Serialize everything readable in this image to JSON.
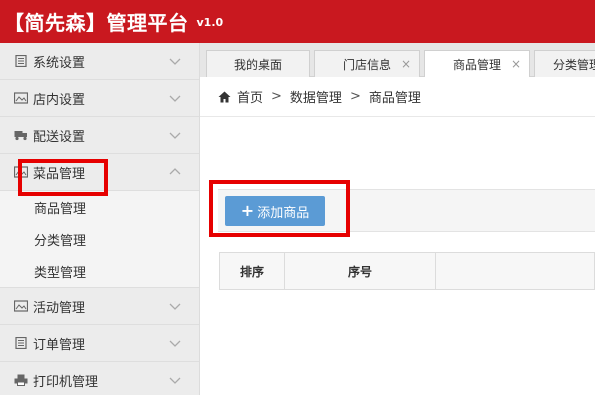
{
  "header": {
    "title": "【简先森】管理平台",
    "version": "v1.0"
  },
  "sidebar": {
    "items": [
      {
        "label": "系统设置",
        "icon": "doc-icon"
      },
      {
        "label": "店内设置",
        "icon": "image-icon"
      },
      {
        "label": "配送设置",
        "icon": "truck-icon"
      },
      {
        "label": "菜品管理",
        "icon": "image-icon",
        "expanded": true,
        "children": [
          {
            "label": "商品管理"
          },
          {
            "label": "分类管理"
          },
          {
            "label": "类型管理"
          }
        ]
      },
      {
        "label": "活动管理",
        "icon": "image-icon"
      },
      {
        "label": "订单管理",
        "icon": "list-icon"
      },
      {
        "label": "打印机管理",
        "icon": "printer-icon"
      }
    ]
  },
  "tabs": [
    {
      "label": "我的桌面",
      "closable": false,
      "active": false
    },
    {
      "label": "门店信息",
      "closable": true,
      "active": false
    },
    {
      "label": "商品管理",
      "closable": true,
      "active": true
    },
    {
      "label": "分类管理",
      "closable": false,
      "active": false
    }
  ],
  "tab_close_glyph": "×",
  "breadcrumb": {
    "items": [
      "首页",
      "数据管理",
      "商品管理"
    ],
    "separator": ">"
  },
  "toolbar": {
    "add_button_label": "添加商品",
    "plus": "+"
  },
  "table": {
    "headers": [
      "排序",
      "序号"
    ]
  },
  "colors": {
    "brand_red": "#c9181f",
    "button_blue": "#5b9bd5",
    "highlight": "#e60000"
  }
}
